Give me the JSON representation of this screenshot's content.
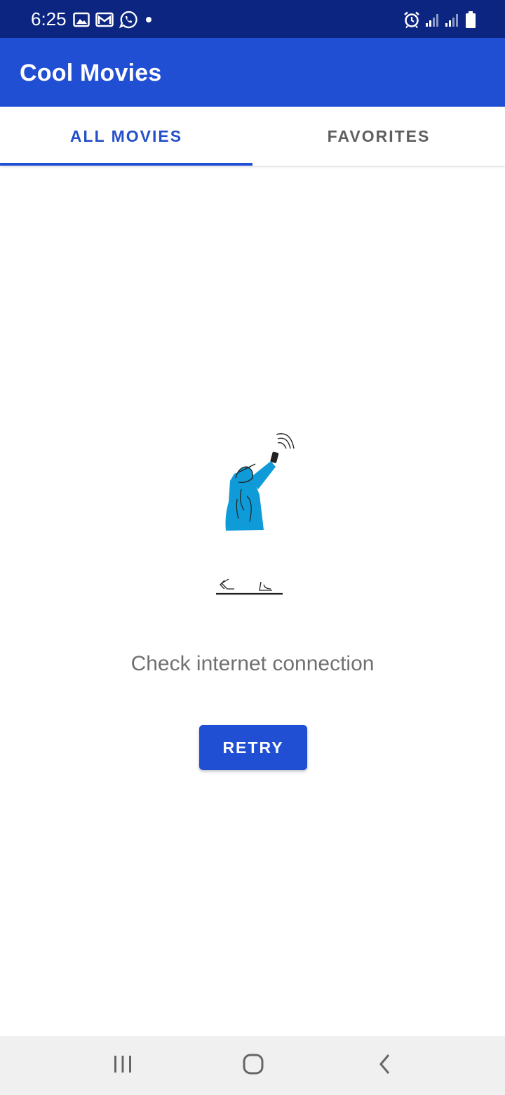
{
  "status_bar": {
    "time": "6:25",
    "left_icons": [
      "gallery-icon",
      "gmail-icon",
      "whatsapp-icon",
      "notification-dot-icon"
    ],
    "right_icons": [
      "alarm-icon",
      "signal-icon",
      "signal-icon",
      "battery-icon"
    ],
    "background": "#0b2580"
  },
  "app_bar": {
    "title": "Cool Movies",
    "background": "#214fd4"
  },
  "tabs": [
    {
      "label": "ALL MOVIES",
      "selected": true
    },
    {
      "label": "FAVORITES",
      "selected": false
    }
  ],
  "main": {
    "illustration": "person-holding-phone-searching-signal",
    "message": "Check internet connection",
    "retry_label": "RETRY"
  },
  "nav_bar": {
    "buttons": [
      "recents-icon",
      "home-icon",
      "back-icon"
    ]
  },
  "colors": {
    "accent": "#214fd4",
    "tab_selected_text": "#2550c8",
    "tab_unselected_text": "#5f5f5f",
    "illustration_blue": "#0f9ad8"
  }
}
